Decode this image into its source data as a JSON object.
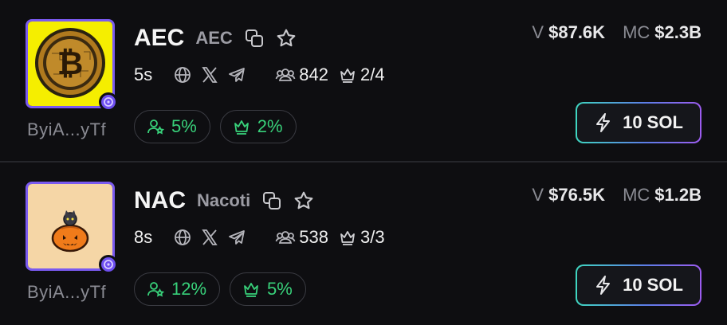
{
  "tokens": [
    {
      "ticker": "AEC",
      "name": "AEC",
      "age": "5s",
      "holders": "842",
      "pro": "2/4",
      "address": "ByiA...yTf",
      "pill1": "5%",
      "pill2": "2%",
      "volume_label": "V",
      "volume": "$87.6K",
      "mc_label": "MC",
      "mc": "$2.3B",
      "buy_label": "10 SOL"
    },
    {
      "ticker": "NAC",
      "name": "Nacoti",
      "age": "8s",
      "holders": "538",
      "pro": "3/3",
      "address": "ByiA...yTf",
      "pill1": "12%",
      "pill2": "5%",
      "volume_label": "V",
      "volume": "$76.5K",
      "mc_label": "MC",
      "mc": "$1.2B",
      "buy_label": "10 SOL"
    }
  ],
  "colors": {
    "background": "#0e0e11",
    "avatar_border": "#7a5af0",
    "pill_text": "#38d17a",
    "muted": "#8a8b93"
  },
  "icons": [
    "copy-icon",
    "star-icon",
    "globe-icon",
    "x-icon",
    "telegram-icon",
    "holders-icon",
    "crown-icon",
    "user-star-icon",
    "lightning-icon",
    "pump-badge-icon"
  ]
}
